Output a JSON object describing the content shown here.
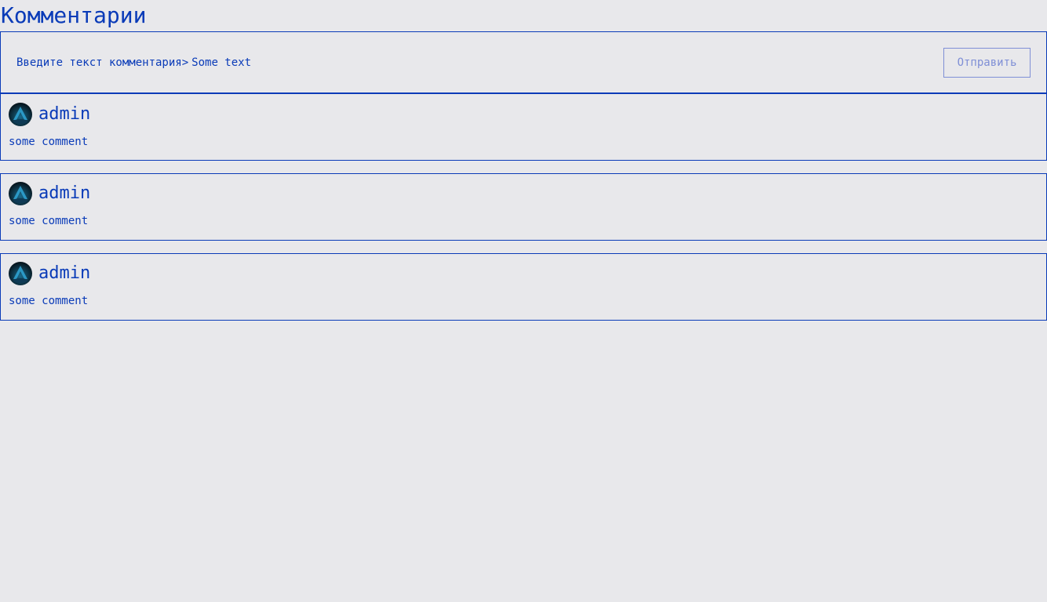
{
  "page": {
    "title": "Комментарии"
  },
  "form": {
    "label": "Введите текст комментария",
    "prompt": ">",
    "input_value": "Some text",
    "submit_label": "Отправить"
  },
  "comments": [
    {
      "author": "admin",
      "text": "some comment",
      "avatar_icon": "avatar-icon"
    },
    {
      "author": "admin",
      "text": "some comment",
      "avatar_icon": "avatar-icon"
    },
    {
      "author": "admin",
      "text": "some comment",
      "avatar_icon": "avatar-icon"
    }
  ],
  "colors": {
    "accent": "#0a3bb8",
    "button_muted": "#7f8fd6",
    "background": "#e8e8eb"
  }
}
